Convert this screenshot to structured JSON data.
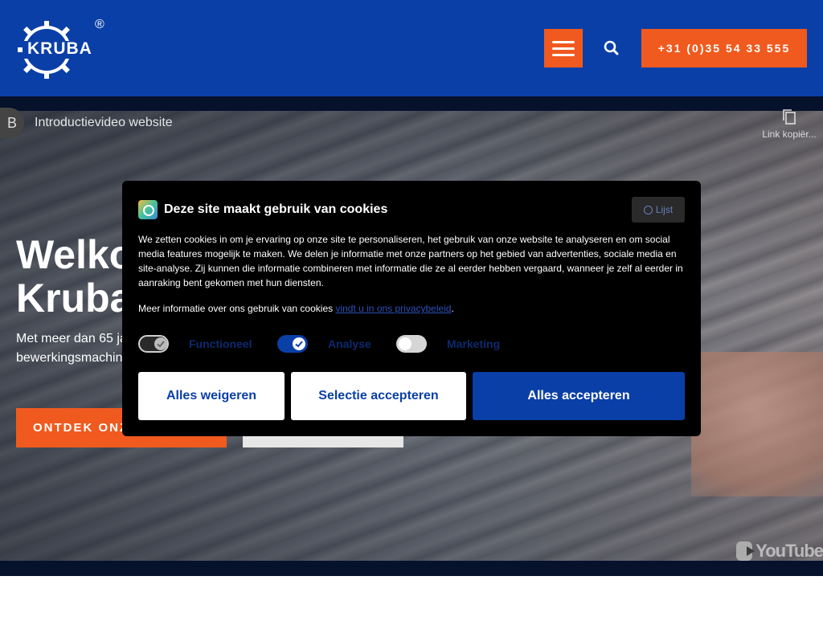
{
  "header": {
    "logo_text": "KRUBA",
    "logo_mark": "®",
    "phone_label": "+31 (0)35 54 33 555"
  },
  "video": {
    "channel_initial": "B",
    "title": "Introductievideo website",
    "copy_link_label": "Link kopiër...",
    "youtube_label": "YouTube"
  },
  "hero": {
    "title_line1": "Welkom bij",
    "title_line2": "Kruba",
    "subtitle_line1": "Met meer dan 65 jaar",
    "subtitle_line2": "bewerkingsmachines",
    "cta_primary": "ONTDEK ONZE MACHINES"
  },
  "cookie": {
    "title": "Deze site maakt gebruik van cookies",
    "list_label": "Lijst",
    "body": "We zetten cookies in om je ervaring op onze site te personaliseren, het gebruik van onze website te analyseren en om social media features mogelijk te maken. We delen je informatie met onze partners op het gebied van advertenties, sociale media en site-analyse. Zij kunnen die informatie combineren met informatie die ze al eerder hebben vergaard, wanneer je zelf al eerder in aanraking bent gekomen met hun diensten.",
    "more_info_prefix": "Meer informatie over ons gebruik van cookies ",
    "more_info_link": "vindt u in ons privacybeleid",
    "more_info_suffix": ".",
    "toggles": [
      {
        "label": "Functioneel",
        "state": "on-locked"
      },
      {
        "label": "Analyse",
        "state": "on"
      },
      {
        "label": "Marketing",
        "state": "off"
      }
    ],
    "buttons": {
      "reject": "Alles weigeren",
      "accept_selection": "Selectie accepteren",
      "accept_all": "Alles accepteren"
    }
  },
  "colors": {
    "brand_blue": "#0a3fa8",
    "accent_orange": "#f05a1e"
  }
}
